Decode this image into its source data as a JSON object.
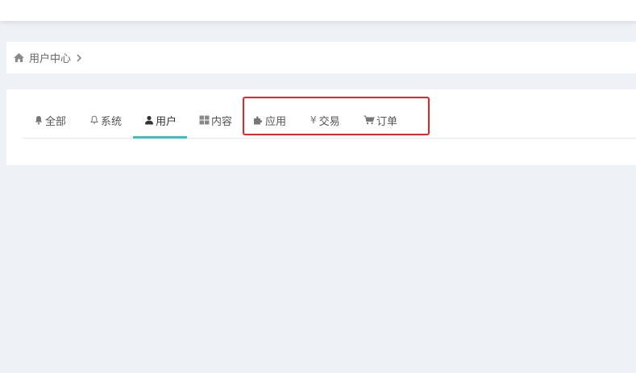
{
  "breadcrumb": {
    "home_icon": "home-icon",
    "current": "用户中心",
    "separator_icon": "chevron-right-icon"
  },
  "tabs": [
    {
      "label": "全部",
      "icon": "bell-filled-icon"
    },
    {
      "label": "系统",
      "icon": "bell-outline-icon"
    },
    {
      "label": "用户",
      "icon": "user-icon",
      "active": true
    },
    {
      "label": "内容",
      "icon": "grid-icon"
    },
    {
      "label": "应用",
      "icon": "puzzle-icon"
    },
    {
      "label": "交易",
      "icon": "yen-icon"
    },
    {
      "label": "订单",
      "icon": "cart-icon"
    }
  ],
  "colors": {
    "active_underline": "#3bbfc1",
    "highlight_border": "#e3262a",
    "background": "#eef1f5"
  }
}
